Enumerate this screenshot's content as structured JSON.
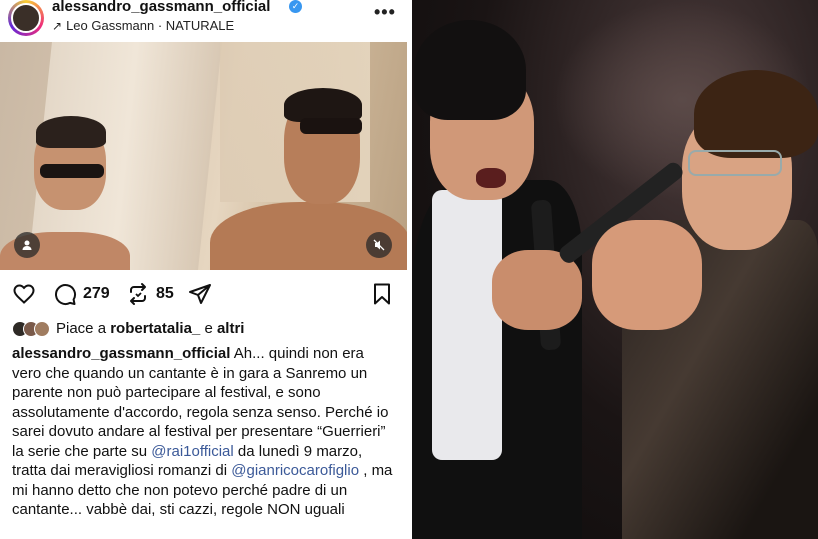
{
  "post": {
    "username": "alessandro_gassmann_official",
    "verified_icon": "verified-badge-icon",
    "audio_line": "Leo Gassmann · NATURALE",
    "more_label": "•••"
  },
  "actions": {
    "comments_count": "279",
    "reposts_count": "85"
  },
  "likes": {
    "prefix": "Piace a",
    "user": "robertatalia_",
    "joiner": "e",
    "others": "altri"
  },
  "caption": {
    "username": "alessandro_gassmann_official",
    "text_1": " Ah... quindi non era vero che quando un cantante è in gara a Sanremo un parente non può partecipare al festival, e sono assolutamente d'accordo, regola senza senso. Perché io sarei dovuto andare al festival per presentare “Guerrieri” la serie che parte su ",
    "mention_1": "@rai1official",
    "text_2": " da lunedì 9 marzo, tratta dai meravigliosi romanzi di ",
    "mention_2": "@gianricocarofiglio",
    "text_3": " , ma mi hanno detto che non potevo perché padre di un cantante... vabbè dai, sti cazzi, regole NON uguali"
  },
  "colors": {
    "mention": "#3b5998",
    "verified": "#3897f0"
  }
}
